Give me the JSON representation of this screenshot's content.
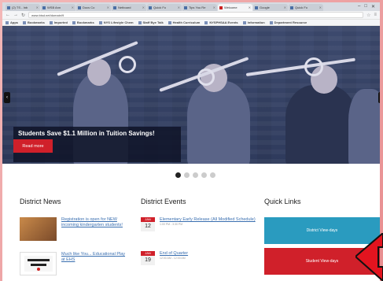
{
  "browser": {
    "tabs": [
      {
        "label": "(2) TS - Inb",
        "active": false
      },
      {
        "label": "WSB Ann",
        "active": false
      },
      {
        "label": "Docs Co",
        "active": false
      },
      {
        "label": "Netboard",
        "active": false
      },
      {
        "label": "Quick Fo",
        "active": false
      },
      {
        "label": "Tips You Re",
        "active": false
      },
      {
        "label": "Welcome",
        "active": true
      },
      {
        "label": "Google",
        "active": false
      },
      {
        "label": "Quick Fo",
        "active": false
      }
    ],
    "window_controls": [
      "–",
      "□",
      "✕"
    ],
    "url": "www.bisd.net/domain/9",
    "bookmarks": [
      "Apps",
      "Bookmarks",
      "Imported",
      "Bookmarks",
      "NYS Lifestyle Chem",
      "Staff Bye Talk",
      "Health Curriculum",
      "NYSPHSAA Events",
      "Information",
      "Department Resource"
    ]
  },
  "hero": {
    "headline": "Students Save $1.1 Million in Tuition Savings!",
    "button": "Read more",
    "prev": "‹",
    "next": "›"
  },
  "carousel": {
    "count": 5,
    "active": 0
  },
  "news": {
    "title": "District News",
    "items": [
      {
        "text": "Registration is open for NEW incoming kindergarten students!"
      },
      {
        "text": "Much like You... Educational Play at EHS"
      }
    ]
  },
  "events": {
    "title": "District Events",
    "items": [
      {
        "month": "JAN",
        "day": "12",
        "title": "Elementary Early Release (All Modified Schedule)",
        "time": "1:00 PM - 3:30 PM"
      },
      {
        "month": "JAN",
        "day": "19",
        "title": "End of Quarter",
        "time": "12:00 AM - 12:00 AM"
      }
    ]
  },
  "quicklinks": {
    "title": "Quick Links",
    "items": [
      {
        "label": "District View-days",
        "color": "#2a9bbf"
      },
      {
        "label": "Student View-days",
        "color": "#d0202a"
      }
    ]
  },
  "colors": {
    "accent": "#d0202a",
    "link": "#3a6fb0",
    "teal": "#2a9bbf"
  }
}
